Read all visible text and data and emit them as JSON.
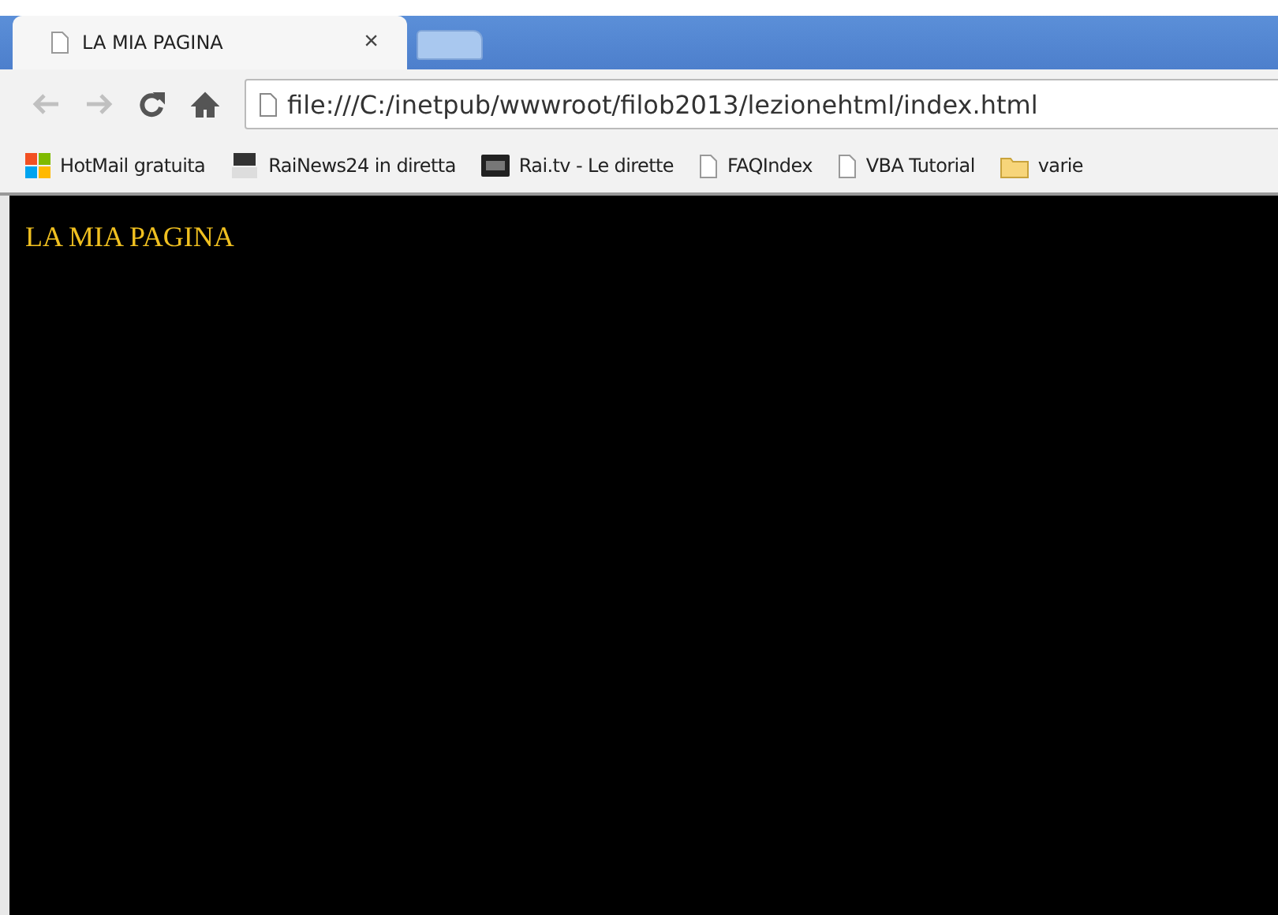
{
  "tabs": [
    {
      "title": "LA MIA PAGINA",
      "close": "×",
      "selected": true
    }
  ],
  "toolbar": {
    "back_disabled": true,
    "forward_disabled": true,
    "address": "file:///C:/inetpub/wwwroot/filob2013/lezionehtml/index.html"
  },
  "bookmarks": [
    {
      "kind": "windows",
      "label": "HotMail gratuita"
    },
    {
      "kind": "rainews",
      "label": "RaiNews24 in diretta"
    },
    {
      "kind": "rai",
      "label": "Rai.tv - Le dirette"
    },
    {
      "kind": "page",
      "label": "FAQIndex"
    },
    {
      "kind": "page",
      "label": "VBA Tutorial"
    },
    {
      "kind": "folder",
      "label": "varie"
    }
  ],
  "page": {
    "heading": "LA MIA PAGINA"
  }
}
